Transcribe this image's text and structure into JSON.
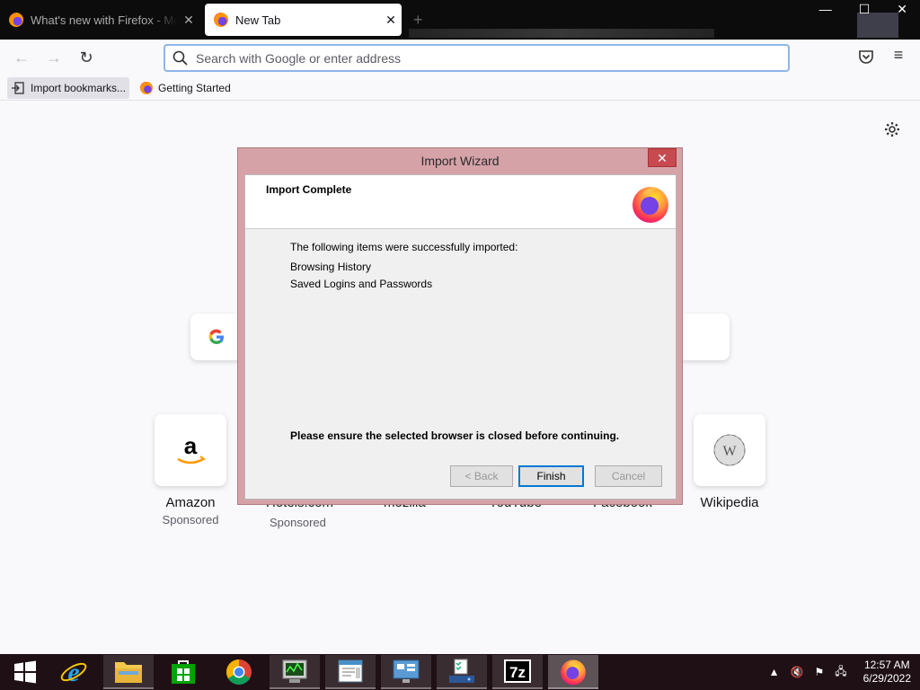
{
  "tabs": [
    {
      "title": "What's new with Firefox - Mozilla",
      "close": "✕"
    },
    {
      "title": "New Tab",
      "close": "✕"
    }
  ],
  "new_tab_symbol": "+",
  "window_controls": {
    "minimize": "—",
    "maximize": "☐",
    "close": "✕"
  },
  "navbar": {
    "back_icon": "←",
    "forward_icon": "→",
    "reload_icon": "↻",
    "url_placeholder": "Search with Google or enter address",
    "menu_icon": "≡"
  },
  "bookmarks": [
    {
      "label": "Import bookmarks...",
      "icon": "import-icon"
    },
    {
      "label": "Getting Started",
      "icon": "firefox-icon"
    }
  ],
  "top_sites": [
    {
      "label": "Amazon",
      "sponsored": "Sponsored",
      "icon": "amazon-logo"
    },
    {
      "label": "Hotels.com",
      "sponsored": "Sponsored"
    },
    {
      "label": "mozilla"
    },
    {
      "label": "YouTube"
    },
    {
      "label": "Facebook"
    },
    {
      "label": "Wikipedia",
      "icon": "wikipedia-logo"
    }
  ],
  "wizard": {
    "title": "Import Wizard",
    "close": "✕",
    "heading": "Import Complete",
    "intro": "The following items were successfully imported:",
    "items": [
      "Browsing History",
      "Saved Logins and Passwords"
    ],
    "warning": "Please ensure the selected browser is closed before continuing.",
    "back_label": "< Back",
    "finish_label": "Finish",
    "cancel_label": "Cancel"
  },
  "taskbar": {
    "apps": [
      "start",
      "internet-explorer",
      "file-explorer",
      "store",
      "chrome",
      "task-manager",
      "notepad",
      "remote-desktop",
      "control-panel",
      "7zip",
      "firefox"
    ],
    "clock_time": "12:57 AM",
    "clock_date": "6/29/2022"
  },
  "colors": {
    "dialog_frame": "#d5a2a8",
    "dialog_close": "#c74a50",
    "taskbar": "#1f1016",
    "accent": "#0078d7"
  }
}
